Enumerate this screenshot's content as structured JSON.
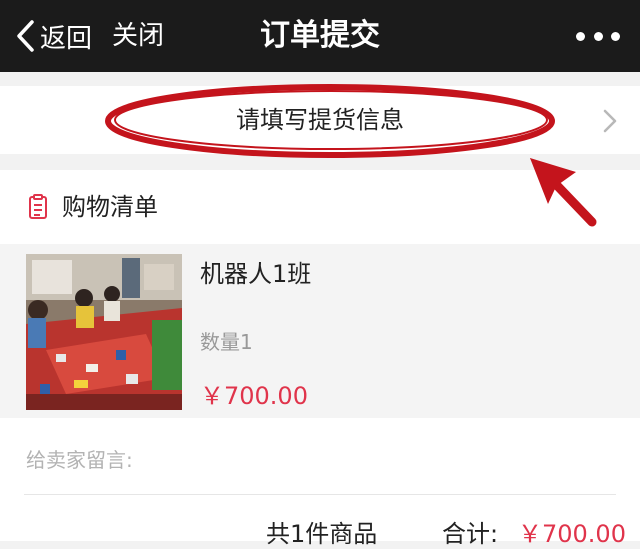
{
  "nav": {
    "back_label": "返回",
    "close_label": "关闭",
    "title": "订单提交",
    "more_icon": "more-icon"
  },
  "pickup": {
    "label": "请填写提货信息",
    "chevron_icon": "chevron-right-icon"
  },
  "shopping_list": {
    "title": "购物清单",
    "icon": "list-icon",
    "items": [
      {
        "name": "机器人1班",
        "quantity": "数量1",
        "price": "￥700.00"
      }
    ]
  },
  "message": {
    "placeholder": "给卖家留言:"
  },
  "summary": {
    "count_text": "共1件商品",
    "total_label": "合计:",
    "total_value": "￥700.00"
  },
  "colors": {
    "nav_bg": "#1b1b1b",
    "accent_red": "#e0344b",
    "annotation_red": "#c4141c"
  }
}
